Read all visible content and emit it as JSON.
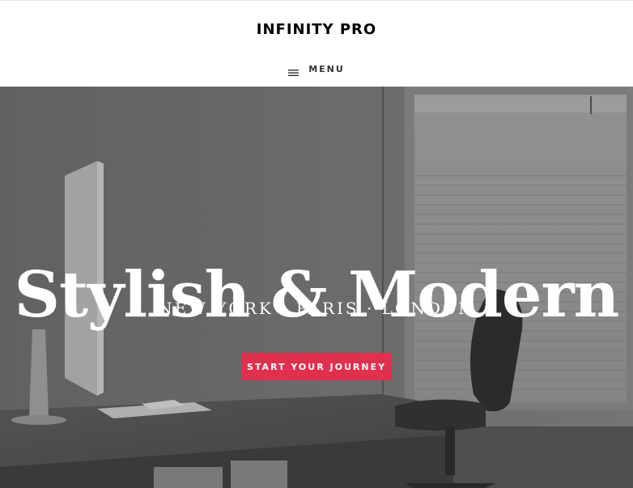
{
  "header": {
    "site_title": "INFINITY PRO",
    "menu_label": "MENU",
    "menu_icon": "hamburger-icon"
  },
  "hero": {
    "title": "Stylish & Modern",
    "subtitle": "NEW YORK · PARIS · LONDON",
    "cta_label": "START YOUR JOURNEY",
    "background": "grayscale office photo: desk with computer monitor and office chair by window with blinds"
  },
  "colors": {
    "accent": "#e0304e",
    "header_bg": "#ffffff",
    "title_text": "#000000",
    "hero_text": "#ffffff"
  }
}
